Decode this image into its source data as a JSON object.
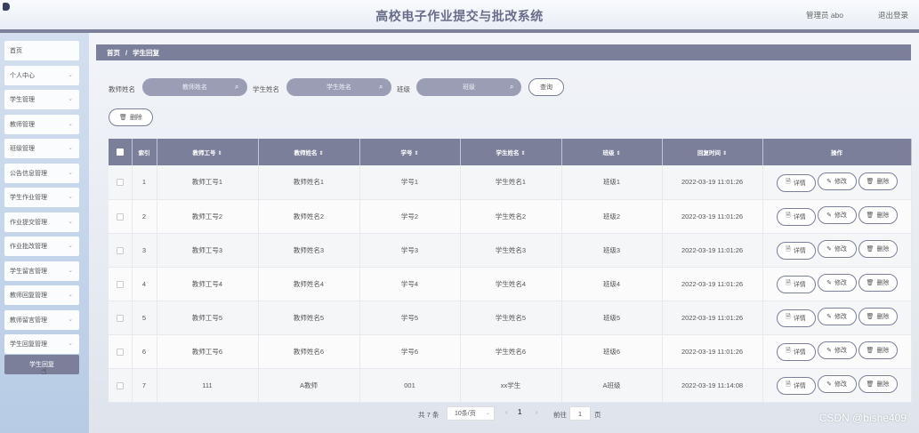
{
  "header": {
    "title": "高校电子作业提交与批改系统",
    "admin": "管理员 abo",
    "logout": "退出登录"
  },
  "sidebar": {
    "items": [
      {
        "label": "首页",
        "chevron": false
      },
      {
        "label": "个人中心",
        "chevron": true
      },
      {
        "label": "学生管理",
        "chevron": true
      },
      {
        "label": "教师管理",
        "chevron": true
      },
      {
        "label": "班级管理",
        "chevron": true
      },
      {
        "label": "公告信息管理",
        "chevron": true
      },
      {
        "label": "学生作业管理",
        "chevron": true
      },
      {
        "label": "作业提交管理",
        "chevron": true
      },
      {
        "label": "作业批改管理",
        "chevron": true
      },
      {
        "label": "学生留言管理",
        "chevron": true
      },
      {
        "label": "教师回复管理",
        "chevron": true
      },
      {
        "label": "教师留言管理",
        "chevron": true
      },
      {
        "label": "学生回复管理",
        "chevron": true
      }
    ],
    "sub_item": "学生回复"
  },
  "breadcrumb": {
    "home": "首页",
    "sep": "/",
    "current": "学生回复"
  },
  "search": {
    "teacher_name_label": "教师姓名",
    "teacher_name_placeholder": "教师姓名",
    "student_name_label": "学生姓名",
    "student_name_placeholder": "学生姓名",
    "class_label": "班级",
    "class_placeholder": "班级",
    "query_button": "查询",
    "delete_button": "删除"
  },
  "table": {
    "columns": [
      "索引",
      "教师工号",
      "教师姓名",
      "学号",
      "学生姓名",
      "班级",
      "回复时间",
      "操作"
    ],
    "rows": [
      {
        "index": "1",
        "teacher_id": "教师工号1",
        "teacher_name": "教师姓名1",
        "student_id": "学号1",
        "student_name": "学生姓名1",
        "class": "班级1",
        "time": "2022-03-19 11:01:26"
      },
      {
        "index": "2",
        "teacher_id": "教师工号2",
        "teacher_name": "教师姓名2",
        "student_id": "学号2",
        "student_name": "学生姓名2",
        "class": "班级2",
        "time": "2022-03-19 11:01:26"
      },
      {
        "index": "3",
        "teacher_id": "教师工号3",
        "teacher_name": "教师姓名3",
        "student_id": "学号3",
        "student_name": "学生姓名3",
        "class": "班级3",
        "time": "2022-03-19 11:01:26"
      },
      {
        "index": "4",
        "teacher_id": "教师工号4",
        "teacher_name": "教师姓名4",
        "student_id": "学号4",
        "student_name": "学生姓名4",
        "class": "班级4",
        "time": "2022-03-19 11:01:26"
      },
      {
        "index": "5",
        "teacher_id": "教师工号5",
        "teacher_name": "教师姓名5",
        "student_id": "学号5",
        "student_name": "学生姓名5",
        "class": "班级5",
        "time": "2022-03-19 11:01:26"
      },
      {
        "index": "6",
        "teacher_id": "教师工号6",
        "teacher_name": "教师姓名6",
        "student_id": "学号6",
        "student_name": "学生姓名6",
        "class": "班级6",
        "time": "2022-03-19 11:01:26"
      },
      {
        "index": "7",
        "teacher_id": "111",
        "teacher_name": "A教师",
        "student_id": "001",
        "student_name": "xx学生",
        "class": "A班级",
        "time": "2022-03-19 11:14:08"
      }
    ],
    "actions": {
      "detail": "详情",
      "edit": "修改",
      "delete": "删除"
    }
  },
  "pagination": {
    "total": "共 7 条",
    "page_size": "10条/页",
    "current_page": "1",
    "goto_label": "前往",
    "goto_value": "1",
    "page_suffix": "页",
    "prev": "‹",
    "next": "›"
  },
  "watermark": "CSDN @bishe409",
  "colors": {
    "accent": "#7c7f99",
    "input": "#9b9db5"
  }
}
